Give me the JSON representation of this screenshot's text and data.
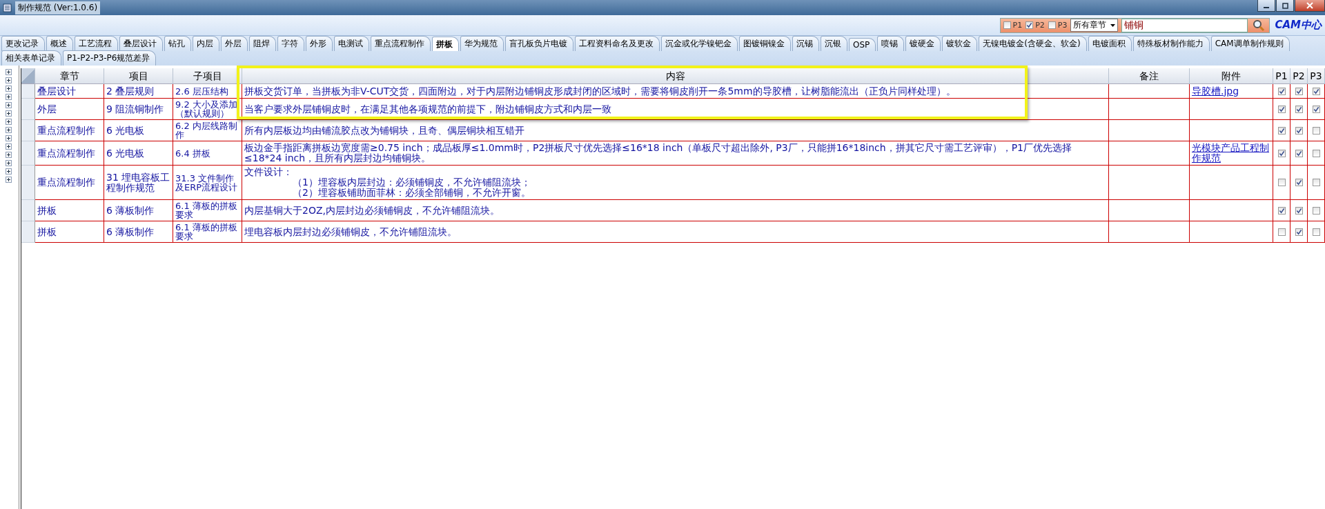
{
  "window": {
    "title": "制作规范 (Ver:1.0.6)"
  },
  "filter": {
    "plants": [
      {
        "label": "P1",
        "checked": false
      },
      {
        "label": "P2",
        "checked": true
      },
      {
        "label": "P3",
        "checked": false
      }
    ],
    "chapter_dropdown": "所有章节",
    "search": {
      "value": "铺铜"
    }
  },
  "logo": "CAM中心",
  "tab_rows": [
    {
      "tabs": [
        {
          "label": "更改记录",
          "selected": false
        },
        {
          "label": "概述",
          "selected": false
        },
        {
          "label": "工艺流程",
          "selected": false
        },
        {
          "label": "叠层设计",
          "selected": false
        },
        {
          "label": "钻孔",
          "selected": false
        },
        {
          "label": "内层",
          "selected": false
        },
        {
          "label": "外层",
          "selected": false
        },
        {
          "label": "阻焊",
          "selected": false
        },
        {
          "label": "字符",
          "selected": false
        },
        {
          "label": "外形",
          "selected": false
        },
        {
          "label": "电测试",
          "selected": false
        },
        {
          "label": "重点流程制作",
          "selected": false
        },
        {
          "label": "拼板",
          "selected": true
        },
        {
          "label": "华为规范",
          "selected": false
        },
        {
          "label": "盲孔板负片电镀",
          "selected": false
        },
        {
          "label": "工程资料命名及更改",
          "selected": false
        },
        {
          "label": "沉金或化学镍钯金",
          "selected": false
        },
        {
          "label": "图镀铜镍金",
          "selected": false
        },
        {
          "label": "沉锡",
          "selected": false
        },
        {
          "label": "沉银",
          "selected": false
        },
        {
          "label": "OSP",
          "selected": false
        },
        {
          "label": "喷锡",
          "selected": false
        },
        {
          "label": "镀硬金",
          "selected": false
        },
        {
          "label": "镀软金",
          "selected": false
        },
        {
          "label": "无镍电镀金(含硬金、软金)",
          "selected": false
        },
        {
          "label": "电镀面积",
          "selected": false
        },
        {
          "label": "特殊板材制作能力",
          "selected": false
        },
        {
          "label": "CAM调单制作规则",
          "selected": false
        }
      ]
    },
    {
      "tabs": [
        {
          "label": "相关表单记录",
          "selected": false
        },
        {
          "label": "P1-P2-P3-P6规范差异",
          "selected": false
        }
      ]
    }
  ],
  "table": {
    "columns": [
      "章节",
      "项目",
      "子项目",
      "内容",
      "备注",
      "附件",
      "P1",
      "P2",
      "P3"
    ],
    "rows": [
      {
        "chapter": "叠层设计",
        "item": "2 叠层规则",
        "subitem": "2.6 层压结构",
        "content": [
          "拼板交货订单，当拼板为非V-CUT交货，四面附边，对于内层附边铺铜皮形成封闭的区域时，需要将铜皮削开一条5mm的导胶槽，让树脂能流出（正负片同样处理）。"
        ],
        "attachment": "导胶槽.jpg",
        "p1": true,
        "p2": true,
        "p3": true
      },
      {
        "chapter": "外层",
        "item": "9 阻流铜制作",
        "subitem": "9.2 大小及添加（默认规则）",
        "content": [
          "当客户要求外层铺铜皮时，在满足其他各项规范的前提下，附边铺铜皮方式和内层一致"
        ],
        "p1": true,
        "p2": true,
        "p3": true
      },
      {
        "chapter": "重点流程制作",
        "item": "6 光电板",
        "subitem": "6.2 内层线路制作",
        "content": [
          "所有内层板边均由铺流胶点改为铺铜块，且奇、偶层铜块相互错开"
        ],
        "p1": true,
        "p2": true,
        "p3": false
      },
      {
        "chapter": "重点流程制作",
        "item": "6 光电板",
        "subitem": "6.4 拼板",
        "content": [
          "板边金手指距离拼板边宽度需≥0.75 inch；成品板厚≤1.0mm时，P2拼板尺寸优先选择≤16*18 inch（单板尺寸超出除外, P3厂，只能拼16*18inch，拼其它尺寸需工艺评审），P1厂优先选择≤18*24 inch，且所有内层封边均铺铜块。"
        ],
        "attachment": "光模块产品工程制作规范",
        "p1": true,
        "p2": true,
        "p3": false
      },
      {
        "chapter": "重点流程制作",
        "item": "31 埋电容板工程制作规范",
        "subitem": "31.3 文件制作及ERP流程设计",
        "content": [
          "文件设计：",
          "（1）埋容板内层封边：必须铺铜皮，不允许铺阻流块；",
          "（2）埋容板铺助面菲林：必须全部铺铜，不允许开窗。"
        ],
        "p1": false,
        "p2": true,
        "p3": false
      },
      {
        "chapter": "拼板",
        "item": "6 薄板制作",
        "subitem": "6.1 薄板的拼板要求",
        "content": [
          "内层基铜大于2OZ,内层封边必须铺铜皮，不允许铺阻流块。"
        ],
        "p1": true,
        "p2": true,
        "p3": false
      },
      {
        "chapter": "拼板",
        "item": "6 薄板制作",
        "subitem": "6.1 薄板的拼板要求",
        "content": [
          "埋电容板内层封边必须铺铜皮，不允许铺阻流块。"
        ],
        "p1": false,
        "p2": true,
        "p3": false
      }
    ]
  }
}
